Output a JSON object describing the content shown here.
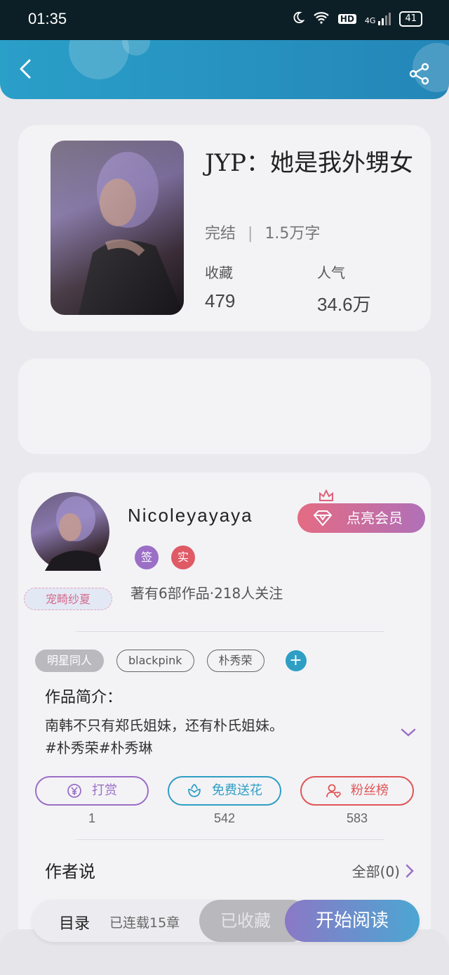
{
  "status_bar": {
    "time": "01:35",
    "network": "4G",
    "hd": "HD",
    "battery": "41"
  },
  "book": {
    "title": "JYP：她是我外甥女",
    "status": "完结",
    "word_count": "1.5万字",
    "favorites_label": "收藏",
    "favorites_value": "479",
    "popularity_label": "人气",
    "popularity_value": "34.6万"
  },
  "author": {
    "name": "Nicoleyayaya",
    "badge": "宠畸纱夏",
    "sign_tag": "签",
    "real_tag": "实",
    "works_info": "著有6部作品·218人关注",
    "vip_button": "点亮会员"
  },
  "tags": [
    "明星同人",
    "blackpink",
    "朴秀荣"
  ],
  "intro": {
    "title": "作品简介：",
    "text_line1": "南韩不只有郑氏姐妹，还有朴氏姐妹。",
    "text_line2": "#朴秀荣#朴秀琳"
  },
  "actions": [
    {
      "label": "打赏",
      "count": "1",
      "color": "#9b6fc6"
    },
    {
      "label": "免费送花",
      "count": "542",
      "color": "#2f9ec4"
    },
    {
      "label": "粉丝榜",
      "count": "583",
      "color": "#e05555"
    }
  ],
  "author_says": {
    "title": "作者说",
    "all_label": "全部(0)"
  },
  "bottom_bar": {
    "catalog": "目录",
    "serial": "已连载15章",
    "collected": "已收藏",
    "read": "开始阅读"
  },
  "icons": [
    "back-icon",
    "share-icon",
    "moon-icon",
    "wifi-icon",
    "signal-icon",
    "battery-icon",
    "diamond-icon",
    "crown-icon",
    "plus-icon",
    "yen-icon",
    "flower-icon",
    "user-heart-icon",
    "chevron-down-icon",
    "chevron-right-icon"
  ]
}
